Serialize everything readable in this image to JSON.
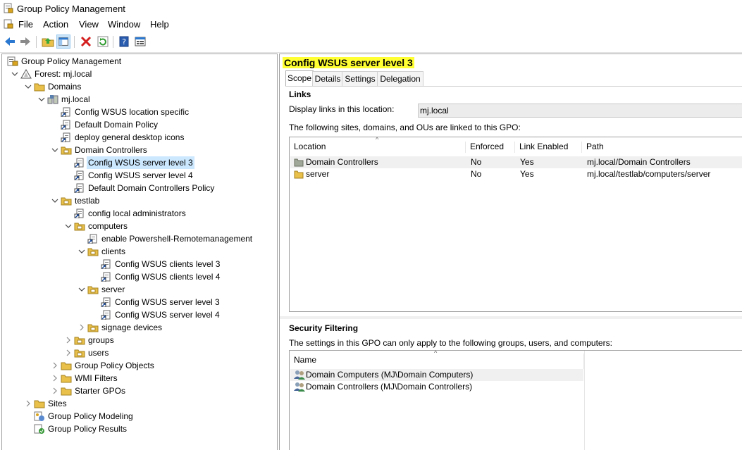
{
  "window": {
    "title": "Group Policy Management"
  },
  "menu": [
    {
      "label": "File"
    },
    {
      "label": "Action"
    },
    {
      "label": "View"
    },
    {
      "label": "Window"
    },
    {
      "label": "Help"
    }
  ],
  "toolbar": {
    "buttons": [
      "back-icon",
      "forward-icon",
      "up-folder-icon",
      "show-hide-tree-icon",
      "delete-icon",
      "refresh-icon",
      "help-icon",
      "properties-icon"
    ]
  },
  "tree": [
    {
      "label": "Group Policy Management",
      "level": 0,
      "icon": "gpm-icon",
      "exp": ""
    },
    {
      "label": "Forest: mj.local",
      "level": 1,
      "icon": "forest-icon",
      "exp": "open"
    },
    {
      "label": "Domains",
      "level": 2,
      "icon": "folder-icon",
      "exp": "open"
    },
    {
      "label": "mj.local",
      "level": 3,
      "icon": "domain-icon",
      "exp": "open"
    },
    {
      "label": "Config WSUS location specific",
      "level": 4,
      "icon": "gpo-link-icon",
      "exp": ""
    },
    {
      "label": "Default Domain Policy",
      "level": 4,
      "icon": "gpo-link-icon",
      "exp": ""
    },
    {
      "label": "deploy general desktop icons",
      "level": 4,
      "icon": "gpo-link-icon",
      "exp": ""
    },
    {
      "label": "Domain Controllers",
      "level": 4,
      "icon": "ou-icon",
      "exp": "open"
    },
    {
      "label": "Config WSUS server level 3",
      "level": 5,
      "icon": "gpo-link-icon",
      "exp": "",
      "selected": true
    },
    {
      "label": "Config WSUS server level 4",
      "level": 5,
      "icon": "gpo-link-icon",
      "exp": ""
    },
    {
      "label": "Default Domain Controllers Policy",
      "level": 5,
      "icon": "gpo-link-icon",
      "exp": ""
    },
    {
      "label": "testlab",
      "level": 4,
      "icon": "ou-icon",
      "exp": "open"
    },
    {
      "label": "config local administrators",
      "level": 5,
      "icon": "gpo-link-icon",
      "exp": ""
    },
    {
      "label": "computers",
      "level": 5,
      "icon": "ou-icon",
      "exp": "open"
    },
    {
      "label": "enable Powershell-Remotemanagement",
      "level": 6,
      "icon": "gpo-link-icon",
      "exp": ""
    },
    {
      "label": "clients",
      "level": 6,
      "icon": "ou-icon",
      "exp": "open"
    },
    {
      "label": "Config WSUS clients level 3",
      "level": 7,
      "icon": "gpo-link-icon",
      "exp": ""
    },
    {
      "label": "Config WSUS clients level 4",
      "level": 7,
      "icon": "gpo-link-icon",
      "exp": ""
    },
    {
      "label": "server",
      "level": 6,
      "icon": "ou-icon",
      "exp": "open"
    },
    {
      "label": "Config WSUS server level 3",
      "level": 7,
      "icon": "gpo-link-icon",
      "exp": ""
    },
    {
      "label": "Config WSUS server level 4",
      "level": 7,
      "icon": "gpo-link-icon",
      "exp": ""
    },
    {
      "label": "signage devices",
      "level": 6,
      "icon": "ou-icon",
      "exp": "closed"
    },
    {
      "label": "groups",
      "level": 5,
      "icon": "ou-icon",
      "exp": "closed"
    },
    {
      "label": "users",
      "level": 5,
      "icon": "ou-icon",
      "exp": "closed"
    },
    {
      "label": "Group Policy Objects",
      "level": 4,
      "icon": "folder-icon",
      "exp": "closed"
    },
    {
      "label": "WMI Filters",
      "level": 4,
      "icon": "folder-icon",
      "exp": "closed"
    },
    {
      "label": "Starter GPOs",
      "level": 4,
      "icon": "folder-icon",
      "exp": "closed"
    },
    {
      "label": "Sites",
      "level": 2,
      "icon": "folder-icon",
      "exp": "closed"
    },
    {
      "label": "Group Policy Modeling",
      "level": 2,
      "icon": "modeling-icon",
      "exp": ""
    },
    {
      "label": "Group Policy Results",
      "level": 2,
      "icon": "results-icon",
      "exp": ""
    }
  ],
  "details": {
    "title": "Config WSUS server level 3",
    "tabs": [
      {
        "label": "Scope",
        "active": true
      },
      {
        "label": "Details",
        "active": false
      },
      {
        "label": "Settings",
        "active": false
      },
      {
        "label": "Delegation",
        "active": false
      }
    ],
    "links": {
      "heading": "Links",
      "display_label": "Display links in this location:",
      "display_value": "mj.local",
      "description": "The following sites, domains, and OUs are linked to this GPO:",
      "columns": [
        "Location",
        "Enforced",
        "Link Enabled",
        "Path"
      ],
      "rows": [
        {
          "location": "Domain Controllers",
          "enforced": "No",
          "enabled": "Yes",
          "path": "mj.local/Domain Controllers"
        },
        {
          "location": "server",
          "enforced": "No",
          "enabled": "Yes",
          "path": "mj.local/testlab/computers/server"
        }
      ]
    },
    "security": {
      "heading": "Security Filtering",
      "description": "The settings in this GPO can only apply to the following groups, users, and computers:",
      "columns": [
        "Name"
      ],
      "rows": [
        {
          "name": "Domain Computers (MJ\\Domain Computers)"
        },
        {
          "name": "Domain Controllers (MJ\\Domain Controllers)"
        }
      ]
    }
  }
}
